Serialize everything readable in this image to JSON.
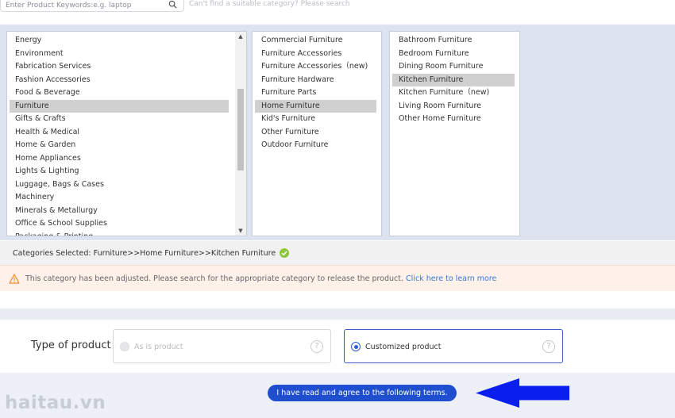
{
  "search": {
    "placeholder": "Enter Product Keywords:e.g. laptop",
    "hint": "Can't find a suitable category? Please search"
  },
  "categories": {
    "level1": [
      "Energy",
      "Environment",
      "Fabrication Services",
      "Fashion Accessories",
      "Food & Beverage",
      "Furniture",
      "Gifts & Crafts",
      "Health & Medical",
      "Home & Garden",
      "Home Appliances",
      "Lights & Lighting",
      "Luggage, Bags & Cases",
      "Machinery",
      "Minerals & Metallurgy",
      "Office & School Supplies",
      "Packaging & Printing"
    ],
    "level1_selected": "Furniture",
    "level2": [
      "Commercial Furniture",
      "Furniture Accessories",
      "Furniture Accessories（new)",
      "Furniture Hardware",
      "Furniture Parts",
      "Home Furniture",
      "Kid's Furniture",
      "Other Furniture",
      "Outdoor Furniture"
    ],
    "level2_selected": "Home Furniture",
    "level3": [
      "Bathroom Furniture",
      "Bedroom Furniture",
      "Dining Room Furniture",
      "Kitchen Furniture",
      "Kitchen Furniture（new)",
      "Living Room Furniture",
      "Other Home Furniture"
    ],
    "level3_selected": "Kitchen Furniture"
  },
  "selected_path": {
    "text": "Categories Selected: Furniture>>Home Furniture>>Kitchen Furniture"
  },
  "warning": {
    "text": "This category has been adjusted. Please search for the appropriate category to release the product. ",
    "link": "Click here to learn more"
  },
  "product_type": {
    "label": "Type of product",
    "options": [
      "As is product",
      "Customized product"
    ],
    "selected": "Customized product"
  },
  "terms_button": "I have read and agree to the following terms.",
  "watermark": "haitau.vn",
  "colors": {
    "accent": "#1f4fcf",
    "selected_row": "#d0d0d0",
    "check": "#8dc63f",
    "warning_bg": "#fdf1ea",
    "arrow": "#0a1ef0"
  }
}
